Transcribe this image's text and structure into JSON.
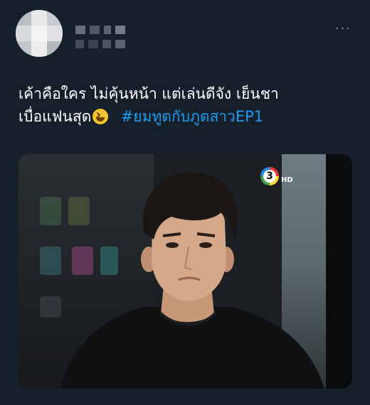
{
  "tweet": {
    "text_line1": "เค้าคือใคร ไม่คุ้นหน้า แต่เล่นดีจัง เย็นชา",
    "text_line2": "เบื่อแฟนสุด",
    "hashtag": "#ยมทูตกับภูตสาวEP1",
    "emoji": "grinning-squinting-face-icon",
    "more_label": "···"
  },
  "media": {
    "channel_number": "3",
    "channel_badge": "HD"
  },
  "colors": {
    "background": "#15202b",
    "text": "#ffffff",
    "link": "#1d9bf0",
    "muted": "#8899a6"
  }
}
